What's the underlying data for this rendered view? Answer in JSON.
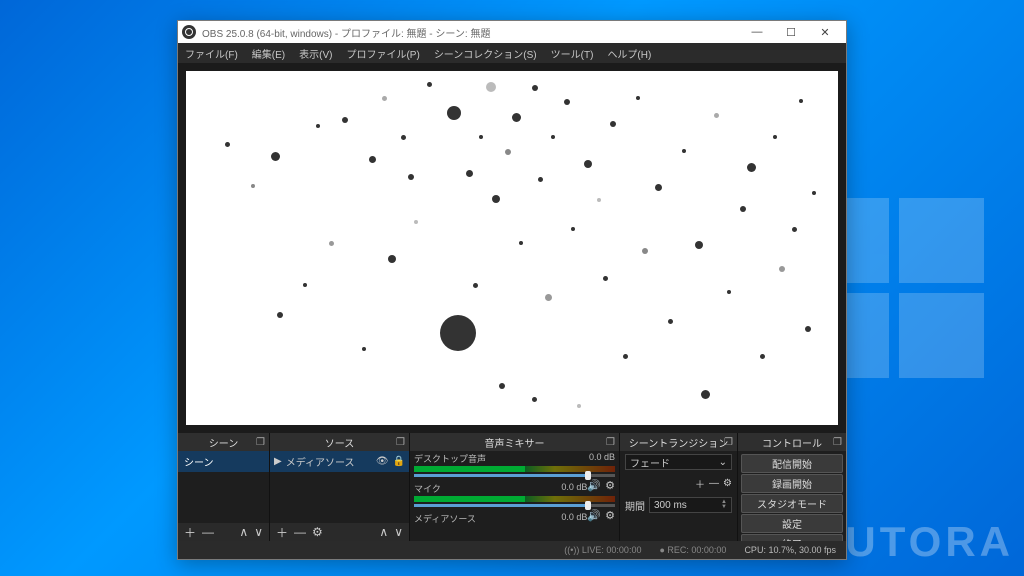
{
  "window": {
    "title": "OBS 25.0.8 (64-bit, windows) - プロファイル: 無題 - シーン: 無題"
  },
  "menu": {
    "file": "ファイル(F)",
    "edit": "編集(E)",
    "view": "表示(V)",
    "profile": "プロファイル(P)",
    "scene_collection": "シーンコレクション(S)",
    "tools": "ツール(T)",
    "help": "ヘルプ(H)"
  },
  "docks": {
    "scenes": {
      "title": "シーン",
      "item": "シーン"
    },
    "sources": {
      "title": "ソース",
      "item": "メディアソース"
    },
    "mixer": {
      "title": "音声ミキサー",
      "ch1": {
        "name": "デスクトップ音声",
        "db": "0.0 dB"
      },
      "ch2": {
        "name": "マイク",
        "db": "0.0 dB"
      },
      "ch3": {
        "name": "メディアソース",
        "db": "0.0 dB"
      }
    },
    "transitions": {
      "title": "シーントランジション",
      "mode": "フェード",
      "duration_label": "期間",
      "duration_value": "300 ms"
    },
    "controls": {
      "title": "コントロール",
      "stream": "配信開始",
      "record": "録画開始",
      "studio": "スタジオモード",
      "settings": "設定",
      "exit": "終了"
    }
  },
  "status": {
    "live": "LIVE: 00:00:00",
    "rec": "REC: 00:00:00",
    "cpu": "CPU: 10.7%, 30.00 fps"
  },
  "icons": {
    "minimize": "—",
    "maximize": "☐",
    "close": "✕",
    "popout": "❐",
    "play": "▶",
    "eye": "👁",
    "lock": "🔒",
    "plus": "＋",
    "minus": "—",
    "gear": "⚙",
    "up": "∧",
    "down": "∨",
    "speaker": "🔊",
    "dropdown": "⌄"
  }
}
